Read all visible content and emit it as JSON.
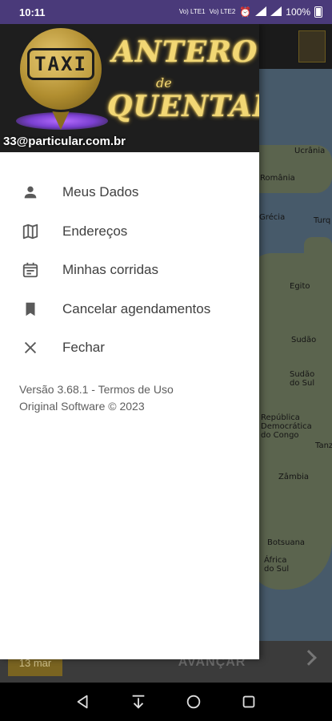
{
  "status_bar": {
    "time": "10:11",
    "indicators": [
      "Vo) LTE1",
      "Vo) LTE2",
      "alarm-icon",
      "signal-icon",
      "signal-icon"
    ],
    "indicator_text_1": "Vo) LTE1",
    "indicator_text_2": "Vo) LTE2",
    "battery": "100%"
  },
  "drawer": {
    "header": {
      "logo_plate_text": "TAXI",
      "brand_line1": "ANTERO",
      "brand_line2": "de",
      "brand_line3": "QUENTAL",
      "user_email": "33@particular.com.br"
    },
    "menu": [
      {
        "label": "Meus Dados",
        "icon": "person-icon"
      },
      {
        "label": "Endereços",
        "icon": "map-icon"
      },
      {
        "label": "Minhas corridas",
        "icon": "calendar-icon"
      },
      {
        "label": "Cancelar agendamentos",
        "icon": "bookmark-icon"
      },
      {
        "label": "Fechar",
        "icon": "close-icon"
      }
    ],
    "footer": {
      "version_prefix": "Versão 3.68.1 - ",
      "terms_link": "Termos de Uso",
      "copyright": "Original Software © 2023"
    }
  },
  "background_app": {
    "map_labels": [
      "Ucrânia",
      "România",
      "Grécia",
      "Turq",
      "Egito",
      "Sudão",
      "Sudão do Sul",
      "República Democrática do Congo",
      "Tanz",
      "Zâmbia",
      "Botsuana",
      "África do Sul"
    ],
    "date_chip": "13 mar",
    "advance_button": "AVANÇAR"
  },
  "colors": {
    "status_bar": "#4a3a7a",
    "header_bg": "#1e1e1e",
    "brand_gold": "#f2d774",
    "menu_text": "#3f3f3f",
    "icon_grey": "#5a5a5a"
  }
}
